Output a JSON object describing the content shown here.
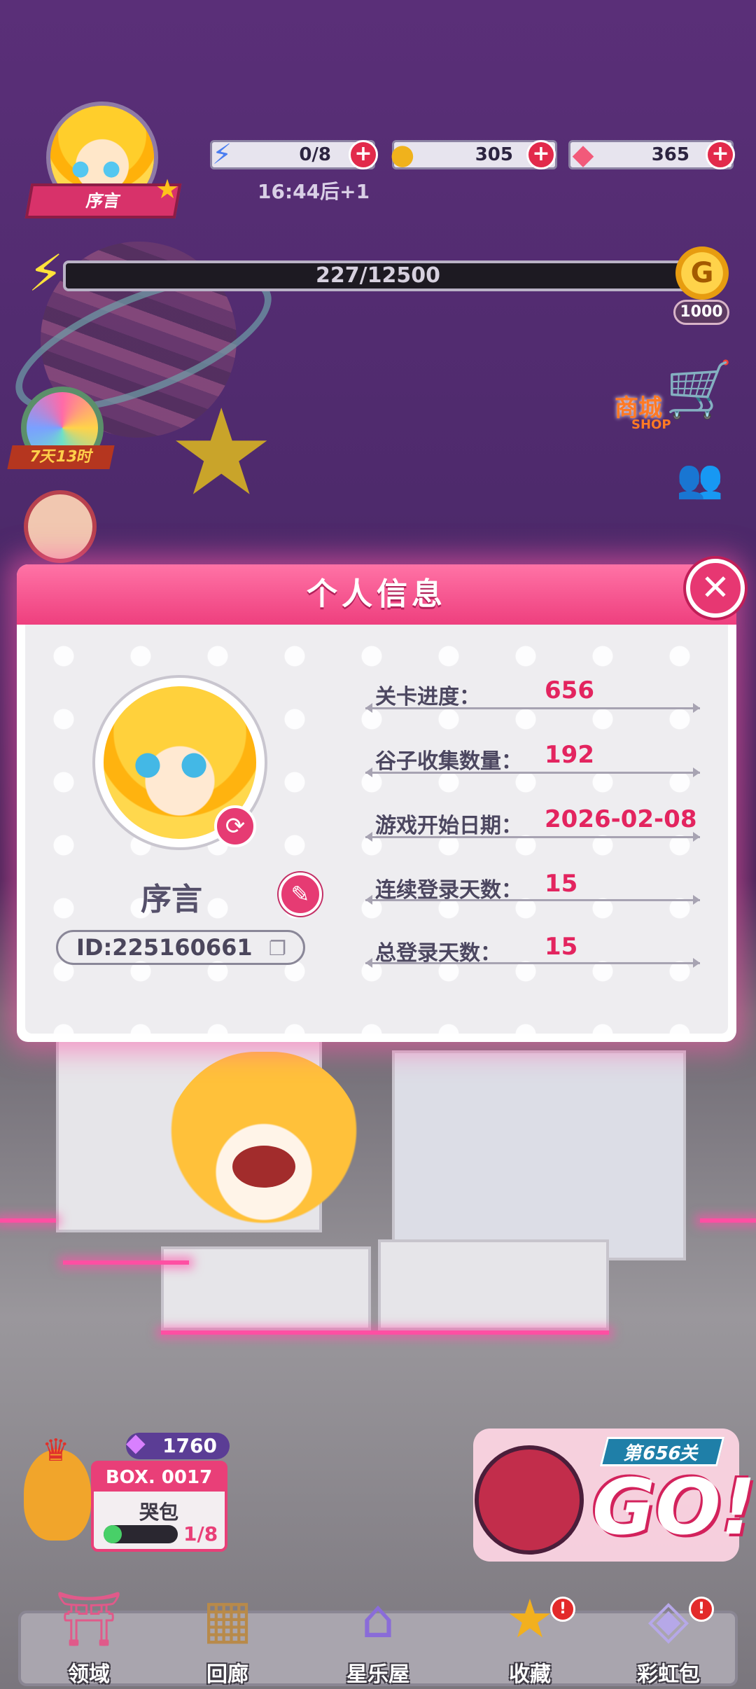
{
  "hud": {
    "player_name": "序言",
    "energy": "0/8",
    "energy_timer": "16:44后+1",
    "coins": "305",
    "gems": "365",
    "exp": "227/12500",
    "gcoin_reward": "1000",
    "event_timer": "7天13时",
    "shop_label": "商城",
    "shop_sub": "SHOP"
  },
  "dialog": {
    "title": "个人信息",
    "player_name": "序言",
    "player_id": "ID:225160661",
    "stats": [
      {
        "label": "关卡进度：",
        "value": "656"
      },
      {
        "label": "谷子收集数量：",
        "value": "192"
      },
      {
        "label": "游戏开始日期：",
        "value": "2026-02-08"
      },
      {
        "label": "连续登录天数：",
        "value": "15"
      },
      {
        "label": "总登录天数：",
        "value": "15"
      }
    ]
  },
  "box": {
    "gem_count": "1760",
    "title": "BOX. 0017",
    "name": "哭包",
    "progress": "1/8",
    "progress_fraction": 0.125
  },
  "go": {
    "level": "第656关",
    "label": "GO!"
  },
  "nav": [
    {
      "label": "领域",
      "icon": "altar-icon",
      "badge": ""
    },
    {
      "label": "回廊",
      "icon": "frame-icon",
      "badge": ""
    },
    {
      "label": "星乐屋",
      "icon": "house-icon",
      "badge": ""
    },
    {
      "label": "收藏",
      "icon": "star-icon",
      "badge": "!"
    },
    {
      "label": "彩虹包",
      "icon": "crystal-icon",
      "badge": "!"
    }
  ],
  "colors": {
    "accent": "#e3245f",
    "header_pink": "#ff73a6",
    "bg_purple": "#5a2f78"
  }
}
